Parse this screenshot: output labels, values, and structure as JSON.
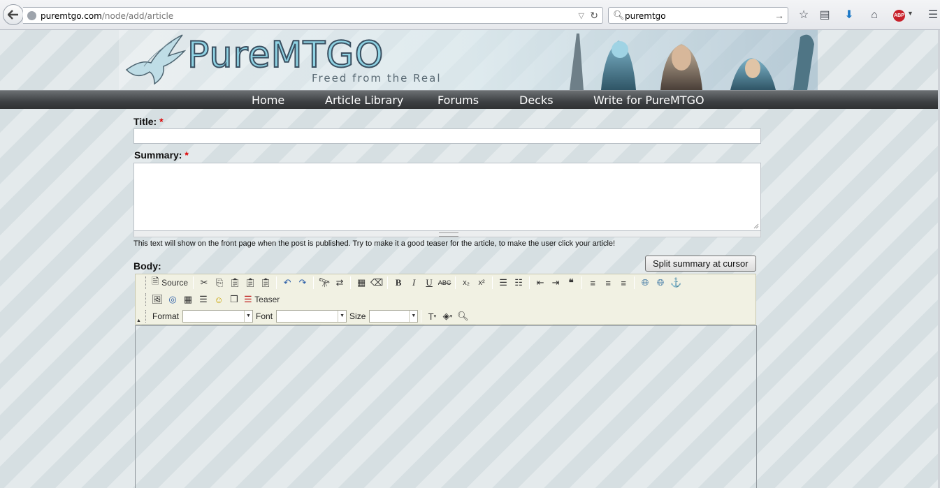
{
  "browser": {
    "url_domain": "puremtgo.com",
    "url_path": "/node/add/article",
    "search_query": "puremtgo",
    "adblock_label": "ABP"
  },
  "site": {
    "logo_text": "PureMTGO",
    "tagline": "Freed from the Real",
    "nav": [
      "Home",
      "Article Library",
      "Forums",
      "Decks",
      "Write for PureMTGO"
    ]
  },
  "form": {
    "title_label": "Title:",
    "summary_label": "Summary:",
    "required_mark": "*",
    "summary_help": "This text will show on the front page when the post is published. Try to make it a good teaser for the article, to make the user click your article!",
    "body_label": "Body:",
    "split_button": "Split summary at cursor"
  },
  "editor": {
    "source_label": "Source",
    "teaser_label": "Teaser",
    "format_label": "Format",
    "font_label": "Font",
    "size_label": "Size",
    "bold": "B",
    "italic": "I",
    "underline": "U",
    "strike": "ABC",
    "subscript": "x₂",
    "superscript": "x²"
  },
  "colors": {
    "nav_bg": "#3d4043",
    "toolbar_bg": "#f1f1e3",
    "required": "#dd0000"
  }
}
